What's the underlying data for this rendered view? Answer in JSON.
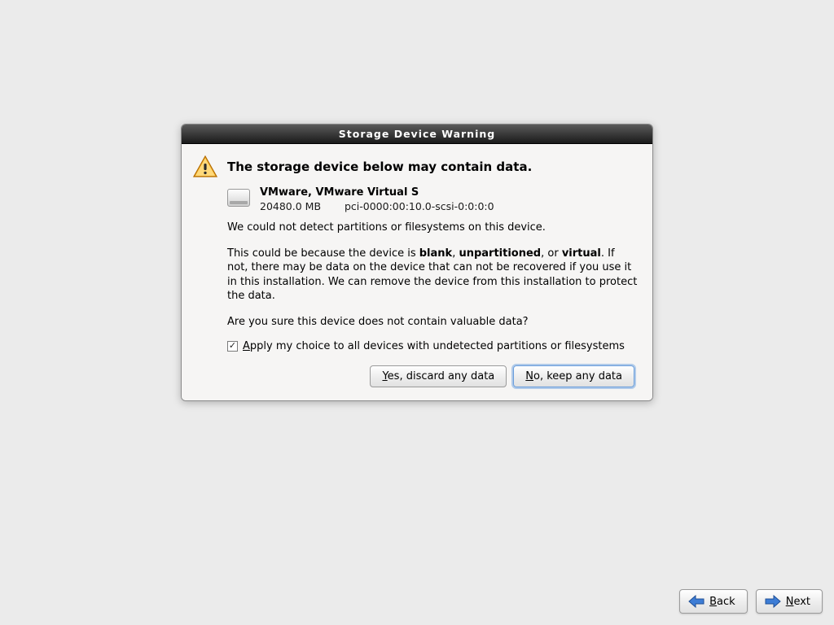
{
  "dialog": {
    "title": "Storage Device Warning",
    "headline": "The storage device below may contain data.",
    "device": {
      "name": "VMware, VMware Virtual S",
      "size": "20480.0 MB",
      "path": "pci-0000:00:10.0-scsi-0:0:0:0"
    },
    "msg_nodetect": "We could not detect partitions or filesystems on this device.",
    "reason_pre": "This could be because the device is ",
    "reason_b1": "blank",
    "reason_sep1": ", ",
    "reason_b2": "unpartitioned",
    "reason_sep2": ", or ",
    "reason_b3": "virtual",
    "reason_post": ". If not, there may be data on the device that can not be recovered if you use it in this installation. We can remove the device from this installation to protect the data.",
    "confirm": "Are you sure this device does not contain valuable data?",
    "checkbox": {
      "checked": true,
      "u": "A",
      "rest": "pply my choice to all devices with undetected partitions or filesystems"
    },
    "buttons": {
      "yes_u": "Y",
      "yes_rest": "es, discard any data",
      "no_u": "N",
      "no_rest": "o, keep any data"
    }
  },
  "nav": {
    "back_u": "B",
    "back_rest": "ack",
    "next_u": "N",
    "next_rest": "ext"
  }
}
